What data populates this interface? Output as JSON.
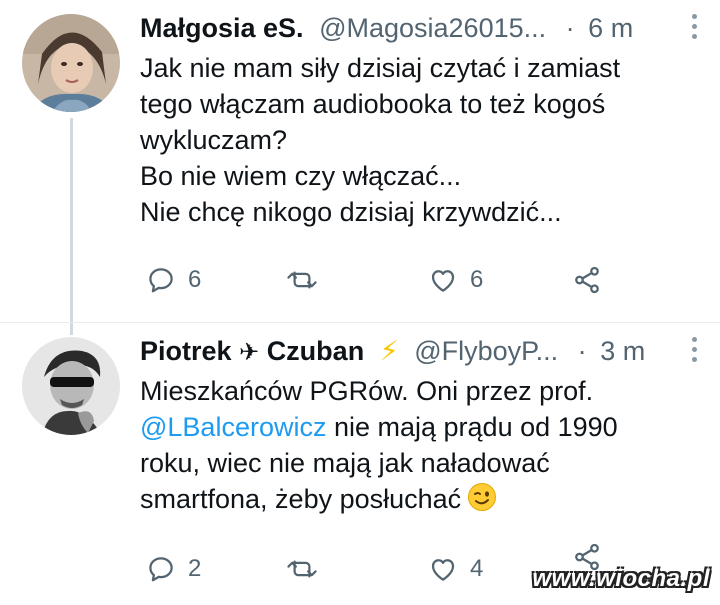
{
  "tweets": [
    {
      "name": "Małgosia eS.",
      "handle": "@Magosia26015...",
      "dot": "·",
      "time": "6 m",
      "lines": [
        "Jak nie mam siły dzisiaj czytać i zamiast",
        "tego włączam audiobooka to też kogoś",
        "wykluczam?",
        "Bo nie wiem czy włączać...",
        "Nie chcę nikogo dzisiaj krzywdzić..."
      ],
      "reply_count": "6",
      "retweet_count": "",
      "like_count": "6"
    },
    {
      "name_first": "Piotrek",
      "name_plane": "✈",
      "name_last": "Czuban",
      "name_bolt": "⚡",
      "handle": "@FlyboyP...",
      "dot": "·",
      "time": "3 m",
      "line1": "Mieszkańców PGRów. Oni przez prof.",
      "mention": "@LBalcerowicz",
      "line2_rest": " nie mają prądu od 1990",
      "line3": "roku, wiec nie mają jak naładować",
      "line4": "smartfona, żeby posłuchać",
      "emoji": "winking-face",
      "reply_count": "2",
      "retweet_count": "",
      "like_count": "4"
    }
  ],
  "watermark": "www.wiocha.pl",
  "colors": {
    "text": "#0f1419",
    "secondary": "#536471",
    "link": "#1d9bf0",
    "divider": "#e6ecf0"
  }
}
